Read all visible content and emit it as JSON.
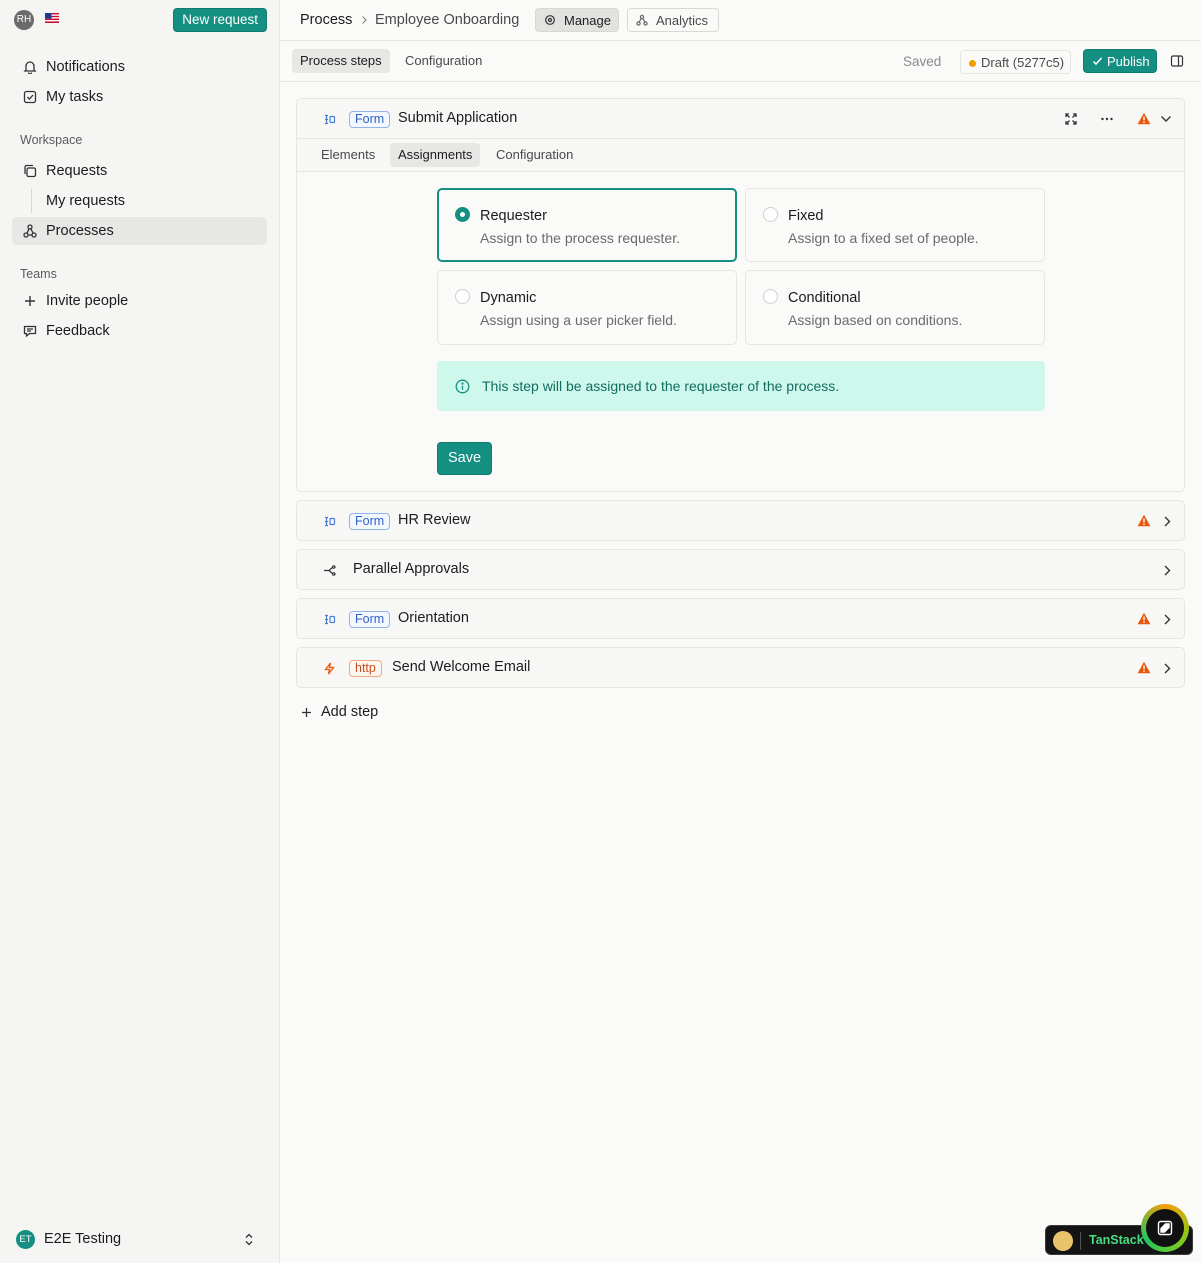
{
  "sidebar": {
    "avatar_initials": "RH",
    "locale_flag": "🇺🇸",
    "new_request_label": "New request",
    "items_top": [
      {
        "label": "Notifications",
        "icon": "bell-icon"
      },
      {
        "label": "My tasks",
        "icon": "checkbox-icon"
      }
    ],
    "workspace_label": "Workspace",
    "workspace_items": [
      {
        "label": "Requests",
        "icon": "copy-icon"
      },
      {
        "label": "My requests",
        "icon": ""
      },
      {
        "label": "Processes",
        "icon": "workflow-icon",
        "active": true
      }
    ],
    "teams_label": "Teams",
    "teams_items": [
      {
        "label": "Invite people",
        "icon": "plus-icon"
      },
      {
        "label": "Feedback",
        "icon": "message-icon"
      }
    ],
    "org": {
      "initials": "ET",
      "name": "E2E Testing"
    }
  },
  "header": {
    "breadcrumb": [
      "Process",
      "Employee Onboarding"
    ],
    "manage_label": "Manage",
    "analytics_label": "Analytics"
  },
  "subbar": {
    "tabs": [
      "Process steps",
      "Configuration"
    ],
    "active_tab": "Process steps",
    "saved_label": "Saved",
    "draft_label": "Draft (5277c5)",
    "publish_label": "Publish"
  },
  "expanded_step": {
    "type": "Form",
    "title": "Submit Application",
    "tabs": [
      "Elements",
      "Assignments",
      "Configuration"
    ],
    "active_tab": "Assignments",
    "options": [
      {
        "title": "Requester",
        "description": "Assign to the process requester.",
        "selected": true
      },
      {
        "title": "Fixed",
        "description": "Assign to a fixed set of people.",
        "selected": false
      },
      {
        "title": "Dynamic",
        "description": "Assign using a user picker field.",
        "selected": false
      },
      {
        "title": "Conditional",
        "description": "Assign based on conditions.",
        "selected": false
      }
    ],
    "info_text": "This step will be assigned to the requester of the process.",
    "save_label": "Save"
  },
  "steps": [
    {
      "type": "Form",
      "title": "HR Review",
      "warning": true
    },
    {
      "type": "",
      "title": "Parallel Approvals",
      "warning": false
    },
    {
      "type": "Form",
      "title": "Orientation",
      "warning": true
    },
    {
      "type": "http",
      "title": "Send Welcome Email",
      "warning": true
    }
  ],
  "add_step_label": "Add step",
  "devtools": {
    "label": "TanStack"
  },
  "colors": {
    "accent": "#148f82",
    "warning": "#e8590c",
    "info_bg": "#cff8ec",
    "draft_dot": "#f0a000"
  }
}
